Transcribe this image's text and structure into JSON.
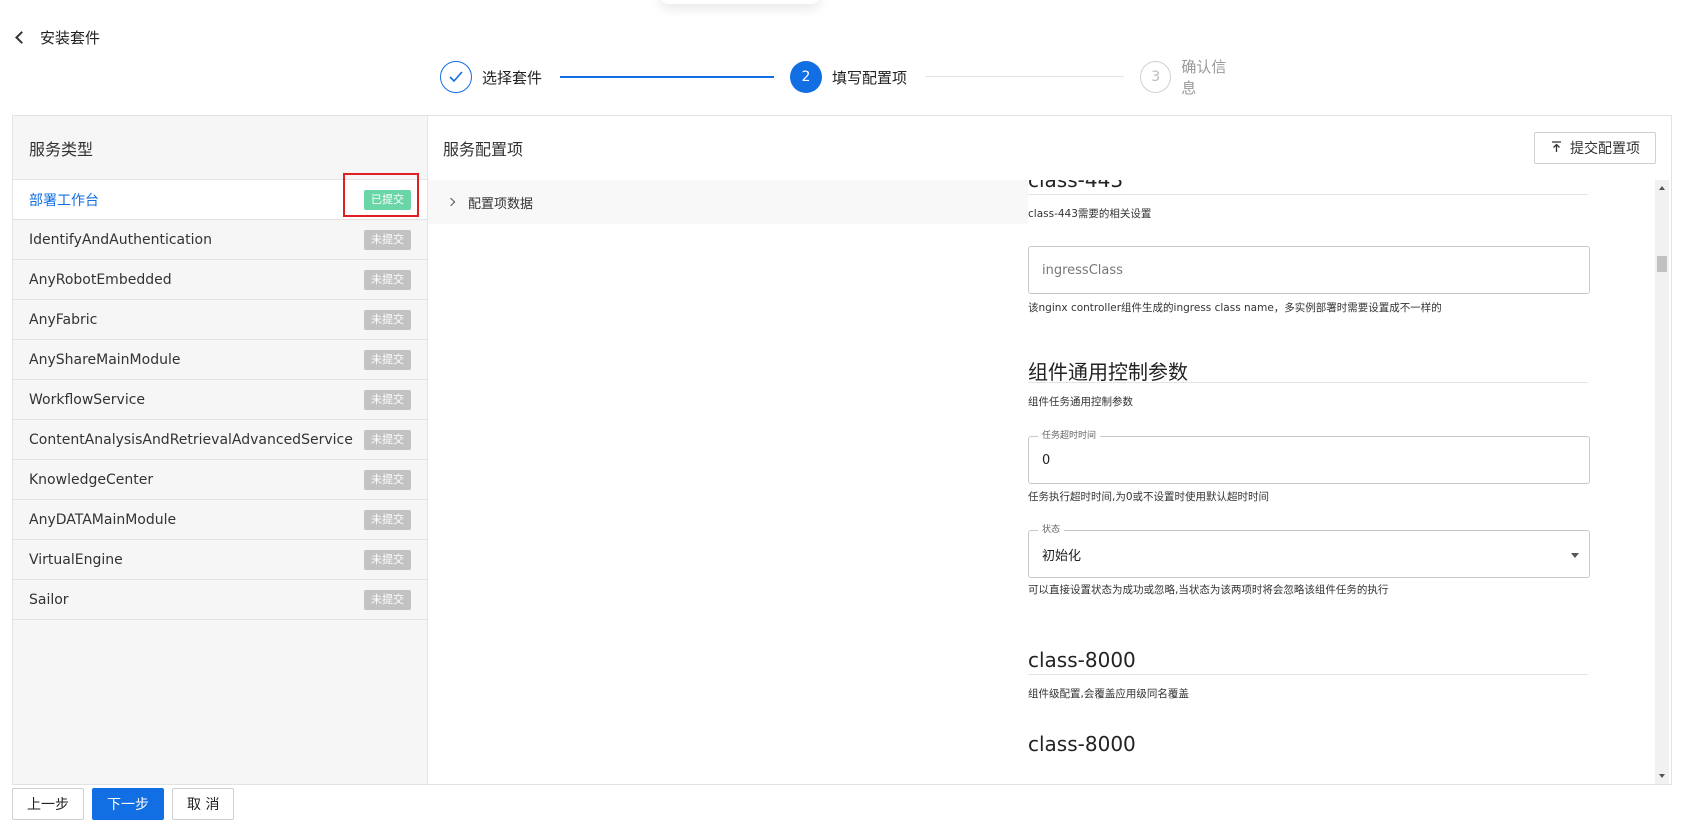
{
  "header": {
    "back_label": "安装套件"
  },
  "steps": [
    {
      "number": "1",
      "label": "选择套件",
      "status": "done"
    },
    {
      "number": "2",
      "label": "填写配置项",
      "status": "active"
    },
    {
      "number": "3",
      "label": "确认信息",
      "status": "pending"
    }
  ],
  "left_panel": {
    "title": "服务类型",
    "items": [
      {
        "name": "部署工作台",
        "status": "已提交"
      },
      {
        "name": "IdentifyAndAuthentication",
        "status": "未提交"
      },
      {
        "name": "AnyRobotEmbedded",
        "status": "未提交"
      },
      {
        "name": "AnyFabric",
        "status": "未提交"
      },
      {
        "name": "AnyShareMainModule",
        "status": "未提交"
      },
      {
        "name": "WorkflowService",
        "status": "未提交"
      },
      {
        "name": "ContentAnalysisAndRetrievalAdvancedService",
        "status": "未提交"
      },
      {
        "name": "KnowledgeCenter",
        "status": "未提交"
      },
      {
        "name": "AnyDATAMainModule",
        "status": "未提交"
      },
      {
        "name": "VirtualEngine",
        "status": "未提交"
      },
      {
        "name": "Sailor",
        "status": "未提交"
      }
    ]
  },
  "right_panel": {
    "title": "服务配置项",
    "submit_label": "提交配置项",
    "config_row_label": "配置项数据",
    "form": {
      "section_443_title": "class-443",
      "section_443_desc": "class-443需要的相关设置",
      "ingress_placeholder": "ingressClass",
      "ingress_help": "该nginx controller组件生成的ingress class name，多实例部署时需要设置成不一样的",
      "general_title": "组件通用控制参数",
      "general_desc": "组件任务通用控制参数",
      "timeout_label": "任务超时时间",
      "timeout_value": "0",
      "timeout_help": "任务执行超时时间,为0或不设置时使用默认超时时间",
      "state_label": "状态",
      "state_value": "初始化",
      "state_help": "可以直接设置状态为成功或忽略,当状态为该两项时将会忽略该组件任务的执行",
      "section_8000_title": "class-8000",
      "section_8000_desc": "组件级配置,会覆盖应用级同名覆盖",
      "section_8000b_title": "class-8000"
    }
  },
  "footer": {
    "prev_label": "上一步",
    "next_label": "下一步",
    "cancel_label": "取 消"
  },
  "colors": {
    "primary": "#126ee3",
    "submitted_badge": "#6ad6a8",
    "pending_badge": "#c2c2c2",
    "highlight_border": "#e02020"
  }
}
